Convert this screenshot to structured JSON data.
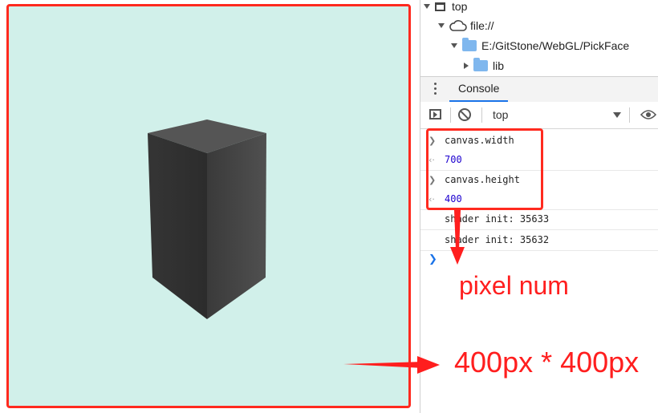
{
  "tree": {
    "items": [
      {
        "label": "top"
      },
      {
        "label": "file://"
      },
      {
        "label": "E:/GitStone/WebGL/PickFace"
      },
      {
        "label": "lib"
      }
    ]
  },
  "tabs": {
    "console_label": "Console"
  },
  "toolbar": {
    "context_value": "top"
  },
  "console": {
    "lines": [
      {
        "kind": "input",
        "text": "canvas.width"
      },
      {
        "kind": "output",
        "text": "700"
      },
      {
        "kind": "input",
        "text": "canvas.height"
      },
      {
        "kind": "output",
        "text": "400"
      },
      {
        "kind": "log",
        "text": "shader init: 35633"
      },
      {
        "kind": "log",
        "text": "shader init: 35632"
      }
    ]
  },
  "annotations": {
    "pixel_label": "pixel num",
    "size_label": "400px * 400px"
  },
  "colors": {
    "canvas_background": "#d1f0ea",
    "annotation_red": "#ff1e1e",
    "number_blue": "#1c00cf",
    "tab_accent": "#1a73e8"
  }
}
